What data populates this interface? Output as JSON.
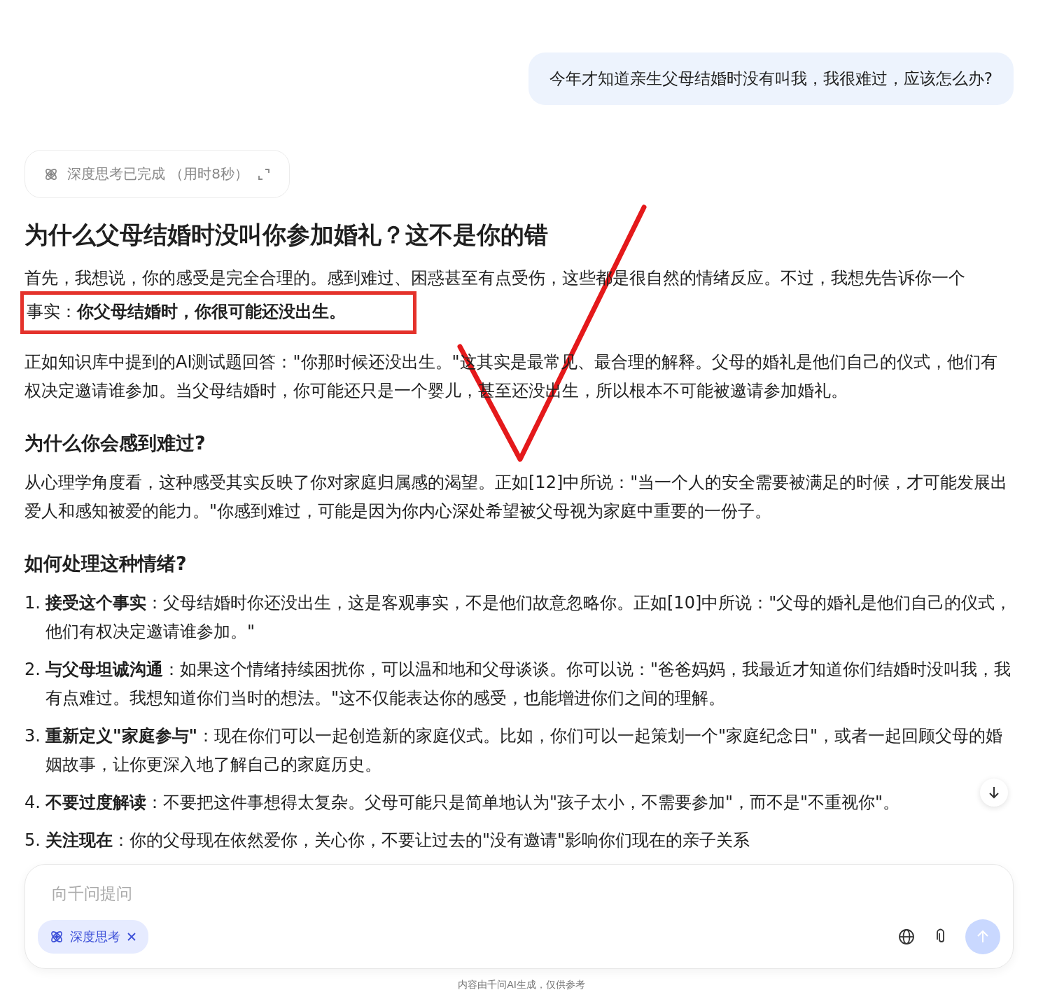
{
  "user_message": "今年才知道亲生父母结婚时没有叫我，我很难过，应该怎么办?",
  "thinking_chip": {
    "label": "深度思考已完成 （用时8秒）",
    "expanded": false
  },
  "answer": [
    {
      "kind": "title",
      "text": "为什么父母结婚时没叫你参加婚礼？这不是你的错"
    },
    {
      "kind": "paragraph",
      "text": "首先，我想说，你的感受是完全合理的。感到难过、困惑甚至有点受伤，这些都是很自然的情绪反应。不过，我想先告诉你一个"
    },
    {
      "kind": "highlight",
      "text": "事实：**你父母结婚时，你很可能还没出生。**"
    },
    {
      "kind": "paragraph",
      "text": "正如知识库中提到的AI测试题回答：\"你那时候还没出生。\"这其实是最常见、最合理的解释。父母的婚礼是他们自己的仪式，他们有权决定邀请谁参加。当父母结婚时，你可能还只是一个婴儿，甚至还没出生，所以根本不可能被邀请参加婚礼。"
    },
    {
      "kind": "heading",
      "text": "为什么你会感到难过?"
    },
    {
      "kind": "paragraph",
      "text": "从心理学角度看，这种感受其实反映了你对家庭归属感的渴望。正如[12]中所说：\"当一个人的安全需要被满足的时候，才可能发展出爱人和感知被爱的能力。\"你感到难过，可能是因为你内心深处希望被父母视为家庭中重要的一份子。"
    },
    {
      "kind": "heading",
      "text": "如何处理这种情绪?"
    },
    {
      "kind": "list",
      "items": [
        {
          "number": "1.",
          "text": "**接受这个事实**：父母结婚时你还没出生，这是客观事实，不是他们故意忽略你。正如[10]中所说：\"父母的婚礼是他们自己的仪式，他们有权决定邀请谁参加。\""
        },
        {
          "number": "2.",
          "text": "**与父母坦诚沟通**：如果这个情绪持续困扰你，可以温和地和父母谈谈。你可以说：\"爸爸妈妈，我最近才知道你们结婚时没叫我，我有点难过。我想知道你们当时的想法。\"这不仅能表达你的感受，也能增进你们之间的理解。"
        },
        {
          "number": "3.",
          "text": "**重新定义\"家庭参与\"**：现在你们可以一起创造新的家庭仪式。比如，你们可以一起策划一个\"家庭纪念日\"，或者一起回顾父母的婚姻故事，让你更深入地了解自己的家庭历史。"
        },
        {
          "number": "4.",
          "text": "**不要过度解读**：不要把这件事想得太复杂。父母可能只是简单地认为\"孩子太小，不需要参加\"，而不是\"不重视你\"。"
        },
        {
          "number": "5.",
          "text": "**关注现在**：你的父母现在依然爱你，关心你，不要让过去的\"没有邀请\"影响你们现在的亲子关系"
        }
      ]
    }
  ],
  "composer": {
    "placeholder": "向千问提问",
    "deep_think": {
      "label": "深度思考",
      "on": true
    },
    "send_disabled": true
  },
  "footer": "内容由千问AI生成，仅供参考"
}
